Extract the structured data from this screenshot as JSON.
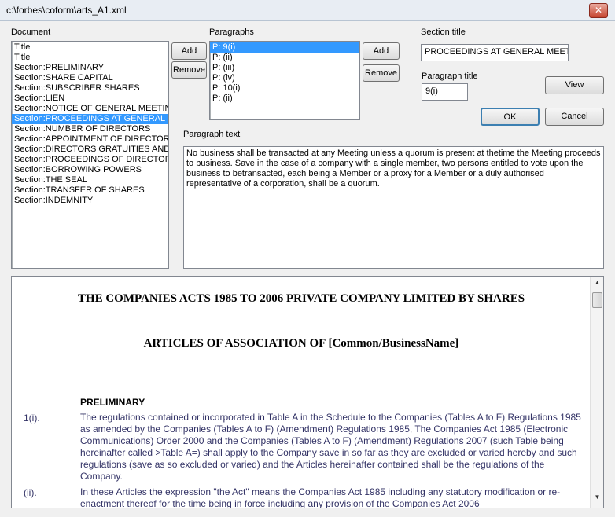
{
  "window": {
    "title": "c:\\forbes\\coform\\arts_A1.xml",
    "close_glyph": "✕"
  },
  "document": {
    "label": "Document",
    "items": [
      "Title",
      "Title",
      "Section:PRELIMINARY",
      "Section:SHARE CAPITAL",
      "Section:SUBSCRIBER SHARES",
      "Section:LIEN",
      "Section:NOTICE OF GENERAL MEETIN",
      "Section:PROCEEDINGS AT GENERAL M",
      "Section:NUMBER OF DIRECTORS",
      "Section:APPOINTMENT OF DIRECTOR",
      "Section:DIRECTORS GRATUITIES AND",
      "Section:PROCEEDINGS OF DIRECTOR",
      "Section:BORROWING POWERS",
      "Section:THE SEAL",
      "Section:TRANSFER OF SHARES",
      "Section:INDEMNITY"
    ],
    "selected_index": 7,
    "add_label": "Add",
    "remove_label": "Remove"
  },
  "paragraphs": {
    "label": "Paragraphs",
    "items": [
      "P: 9(i)",
      "P: (ii)",
      "P: (iii)",
      "P: (iv)",
      "P: 10(i)",
      "P: (ii)"
    ],
    "selected_index": 0,
    "add_label": "Add",
    "remove_label": "Remove"
  },
  "section_title": {
    "label": "Section title",
    "value": "PROCEEDINGS AT GENERAL MEET"
  },
  "paragraph_title": {
    "label": "Paragraph title",
    "value": "9(i)"
  },
  "buttons": {
    "view": "View",
    "ok": "OK",
    "cancel": "Cancel"
  },
  "paragraph_text": {
    "label": "Paragraph text",
    "value": "No business shall be transacted at any Meeting unless a quorum is present at thetime the Meeting proceeds to business. Save in the case of a company with a single member, two persons entitled to vote upon the business to betransacted, each being a Member or a proxy for a Member or a duly authorised representative of a corporation, shall be a quorum."
  },
  "preview": {
    "heading1": "THE COMPANIES ACTS 1985 TO 2006 PRIVATE COMPANY LIMITED BY SHARES",
    "heading2": "ARTICLES OF ASSOCIATION OF [Common/BusinessName]",
    "section": "PRELIMINARY",
    "para1_num": "1(i).",
    "para1_text": "The regulations contained or incorporated in Table A in the Schedule to the Companies (Tables A to F) Regulations 1985 as amended by the Companies (Tables A to F) (Amendment) Regulations 1985, The Companies Act 1985 (Electronic Communications) Order 2000 and the Companies (Tables A to F) (Amendment) Regulations 2007 (such Table being hereinafter called >Table A=) shall apply to the Company save in so far as they are excluded or varied hereby and such regulations (save as so excluded or varied) and the Articles hereinafter contained shall be the regulations of the Company.",
    "para2_num": "(ii).",
    "para2_text": "In these Articles the expression \"the Act\" means the Companies Act 1985 including any statutory modification or re-enactment thereof for the time being in force including any provision of the Companies Act 2006"
  }
}
